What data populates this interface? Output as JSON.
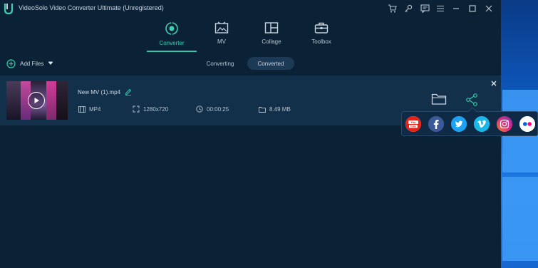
{
  "window": {
    "title": "VideoSolo Video Converter Ultimate (Unregistered)"
  },
  "nav": {
    "tabs": [
      {
        "label": "Converter",
        "icon": "converter-icon",
        "active": true
      },
      {
        "label": "MV",
        "icon": "mv-icon",
        "active": false
      },
      {
        "label": "Collage",
        "icon": "collage-icon",
        "active": false
      },
      {
        "label": "Toolbox",
        "icon": "toolbox-icon",
        "active": false
      }
    ]
  },
  "toolbar": {
    "add_files_label": "Add Files",
    "status_tabs": [
      {
        "label": "Converting",
        "selected": false
      },
      {
        "label": "Converted",
        "selected": true
      }
    ]
  },
  "file": {
    "name": "New MV (1).mp4",
    "format": "MP4",
    "resolution": "1280x720",
    "duration": "00:00:25",
    "size": "8.49 MB"
  },
  "share": {
    "services": [
      {
        "name": "YouTube",
        "glyph": "You\nTube",
        "color": "#e62117"
      },
      {
        "name": "Facebook",
        "glyph": "f",
        "color": "#3b5998"
      },
      {
        "name": "Twitter",
        "glyph": "t",
        "color": "#1da1f2"
      },
      {
        "name": "Vimeo",
        "glyph": "v",
        "color": "#1ab7ea"
      },
      {
        "name": "Instagram",
        "glyph": "ig",
        "color": "#b04bd6"
      },
      {
        "name": "Flickr",
        "glyph": "flickr",
        "color": "#ffffff"
      }
    ]
  },
  "colors": {
    "accent": "#30c9a8",
    "background": "#0b2236",
    "row": "#13304a"
  }
}
